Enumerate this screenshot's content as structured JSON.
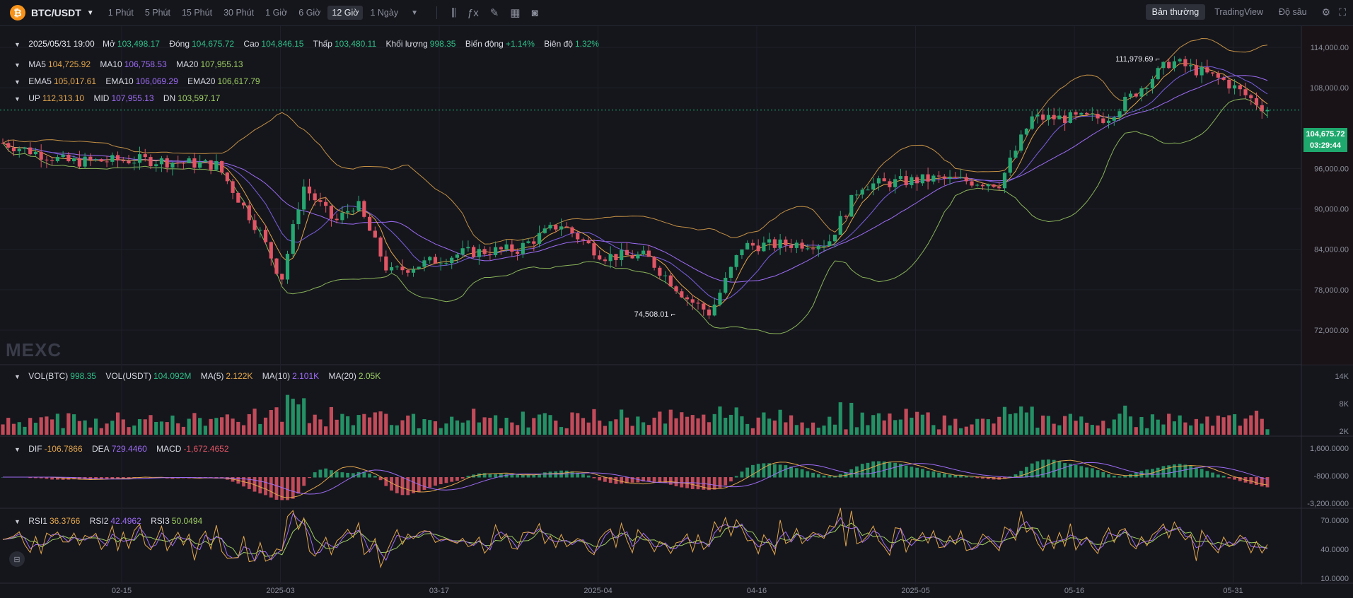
{
  "header": {
    "coin_glyph": "₿",
    "symbol": "BTC/USDT",
    "intervals": [
      "1 Phút",
      "5 Phút",
      "15 Phút",
      "30 Phút",
      "1 Giờ",
      "6 Giờ",
      "12 Giờ",
      "1 Ngày"
    ],
    "active_interval": "12 Giờ",
    "view_tabs": [
      "Bản thường",
      "TradingView",
      "Độ sâu"
    ],
    "active_view": "Bản thường"
  },
  "ohlc": {
    "date": "2025/05/31 19:00",
    "open_label": "Mở",
    "open": "103,498.17",
    "close_label": "Đóng",
    "close": "104,675.72",
    "high_label": "Cao",
    "high": "104,846.15",
    "low_label": "Thấp",
    "low": "103,480.11",
    "volume_label": "Khối lượng",
    "volume": "998.35",
    "change_label": "Biến động",
    "change": "+1.14%",
    "amplitude_label": "Biên độ",
    "amplitude": "1.32%"
  },
  "ma": {
    "ma5_label": "MA5",
    "ma5": "104,725.92",
    "ma10_label": "MA10",
    "ma10": "106,758.53",
    "ma20_label": "MA20",
    "ma20": "107,955.13"
  },
  "ema": {
    "ema5_label": "EMA5",
    "ema5": "105,017.61",
    "ema10_label": "EMA10",
    "ema10": "106,069.29",
    "ema20_label": "EMA20",
    "ema20": "106,617.79"
  },
  "boll": {
    "up_label": "UP",
    "up": "112,313.10",
    "mid_label": "MID",
    "mid": "107,955.13",
    "dn_label": "DN",
    "dn": "103,597.17"
  },
  "volume": {
    "btc_label": "VOL(BTC)",
    "btc": "998.35",
    "usdt_label": "VOL(USDT)",
    "usdt": "104.092M",
    "ma5_label": "MA(5)",
    "ma5": "2.122K",
    "ma10_label": "MA(10)",
    "ma10": "2.101K",
    "ma20_label": "MA(20)",
    "ma20": "2.05K"
  },
  "macd": {
    "dif_label": "DIF",
    "dif": "-106.7866",
    "dea_label": "DEA",
    "dea": "729.4460",
    "macd_label": "MACD",
    "macd": "-1,672.4652"
  },
  "rsi": {
    "rsi1_label": "RSI1",
    "rsi1": "36.3766",
    "rsi2_label": "RSI2",
    "rsi2": "42.4962",
    "rsi3_label": "RSI3",
    "rsi3": "50.0494"
  },
  "price_marker": {
    "price": "104,675.72",
    "countdown": "03:29:44"
  },
  "watermark": "MEXC",
  "colors": {
    "up": "#26a772",
    "down": "#e15565",
    "ma5": "#e3a64b",
    "ma10": "#9e6cf6",
    "ma20": "#9fcf63",
    "accent": "#1fa86d"
  },
  "chart_data": {
    "type": "candlestick",
    "price_axis": [
      "114,000.00",
      "108,000.00",
      "96,000.00",
      "90,000.00",
      "84,000.00",
      "78,000.00",
      "72,000.00"
    ],
    "volume_axis": [
      "14K",
      "8K",
      "2K"
    ],
    "macd_axis": [
      "1,600.0000",
      "-800.0000",
      "-3,200.0000"
    ],
    "rsi_axis": [
      "70.0000",
      "40.0000",
      "10.0000"
    ],
    "x_labels": [
      "02-15",
      "2025-03",
      "03-17",
      "2025-04",
      "04-16",
      "2025-05",
      "05-16",
      "05-31"
    ],
    "high_annotation": "111,979.69",
    "low_annotation": "74,508.01",
    "close_price": 104675.72,
    "price_keypoints": [
      {
        "date": "2025-02-02",
        "price": 99800
      },
      {
        "date": "2025-02-08",
        "price": 97000
      },
      {
        "date": "2025-02-15",
        "price": 97300
      },
      {
        "date": "2025-02-22",
        "price": 96500
      },
      {
        "date": "2025-02-26",
        "price": 86500
      },
      {
        "date": "2025-02-28",
        "price": 79500
      },
      {
        "date": "2025-03-02",
        "price": 93500
      },
      {
        "date": "2025-03-05",
        "price": 88000
      },
      {
        "date": "2025-03-07",
        "price": 91000
      },
      {
        "date": "2025-03-10",
        "price": 80500
      },
      {
        "date": "2025-03-17",
        "price": 83500
      },
      {
        "date": "2025-03-22",
        "price": 84000
      },
      {
        "date": "2025-03-26",
        "price": 87800
      },
      {
        "date": "2025-03-30",
        "price": 83000
      },
      {
        "date": "2025-04-03",
        "price": 83000
      },
      {
        "date": "2025-04-07",
        "price": 76500
      },
      {
        "date": "2025-04-09",
        "price": 74508
      },
      {
        "date": "2025-04-12",
        "price": 84500
      },
      {
        "date": "2025-04-20",
        "price": 85000
      },
      {
        "date": "2025-04-23",
        "price": 93500
      },
      {
        "date": "2025-04-30",
        "price": 94500
      },
      {
        "date": "2025-05-06",
        "price": 93800
      },
      {
        "date": "2025-05-09",
        "price": 103500
      },
      {
        "date": "2025-05-16",
        "price": 103500
      },
      {
        "date": "2025-05-22",
        "price": 111979.69
      },
      {
        "date": "2025-05-27",
        "price": 109000
      },
      {
        "date": "2025-05-31",
        "price": 104675.72
      }
    ]
  }
}
